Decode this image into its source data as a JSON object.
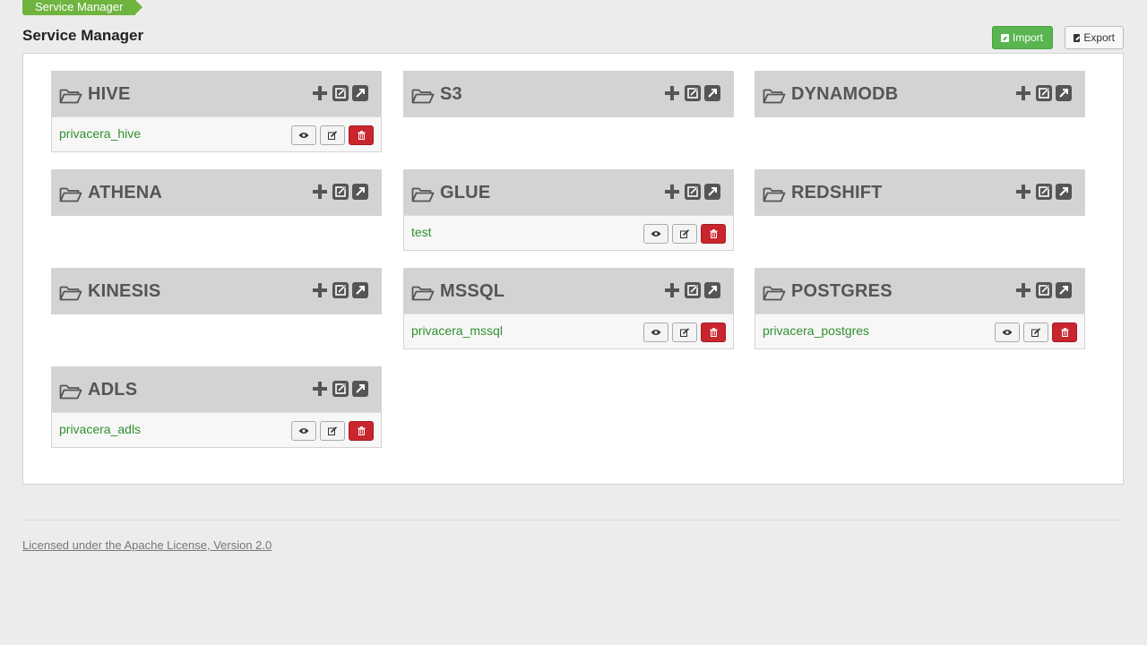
{
  "breadcrumb": {
    "label": "Service Manager"
  },
  "page": {
    "title": "Service Manager"
  },
  "toolbar": {
    "import_label": "Import",
    "export_label": "Export"
  },
  "services": [
    {
      "name": "HIVE",
      "repos": [
        "privacera_hive"
      ]
    },
    {
      "name": "S3",
      "repos": []
    },
    {
      "name": "DYNAMODB",
      "repos": []
    },
    {
      "name": "ATHENA",
      "repos": []
    },
    {
      "name": "GLUE",
      "repos": [
        "test"
      ]
    },
    {
      "name": "REDSHIFT",
      "repos": []
    },
    {
      "name": "KINESIS",
      "repos": []
    },
    {
      "name": "MSSQL",
      "repos": [
        "privacera_mssql"
      ]
    },
    {
      "name": "POSTGRES",
      "repos": [
        "privacera_postgres"
      ]
    },
    {
      "name": "ADLS",
      "repos": [
        "privacera_adls"
      ]
    }
  ],
  "footer": {
    "license_text": "Licensed under the Apache License, Version 2.0"
  },
  "colors": {
    "accent_green": "#58b550",
    "link_green": "#2f8f2f",
    "delete_red": "#c9252f"
  }
}
